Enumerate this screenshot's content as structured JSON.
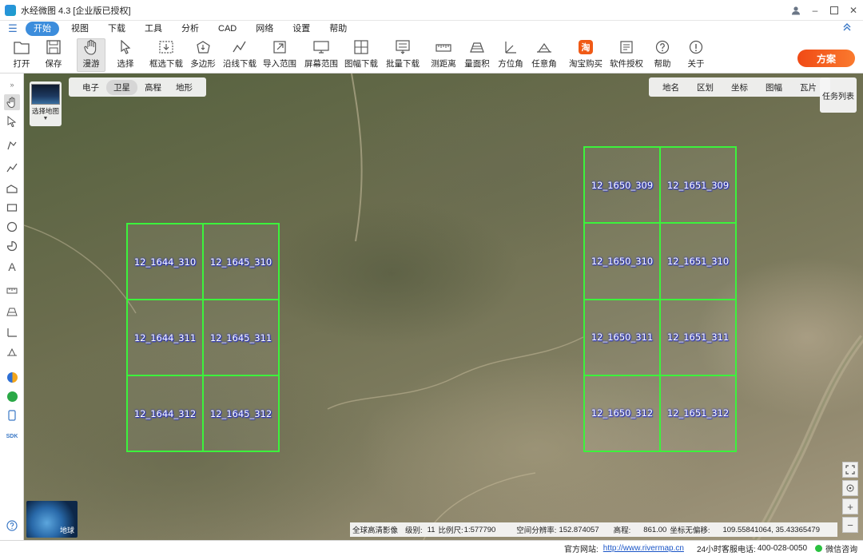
{
  "window": {
    "title": "水经微图 4.3 [企业版已授权]",
    "controls": [
      "user-icon",
      "minimize-icon",
      "maximize-icon",
      "close-icon"
    ]
  },
  "menu": {
    "items": [
      "开始",
      "视图",
      "下载",
      "工具",
      "分析",
      "CAD",
      "网络",
      "设置",
      "帮助"
    ],
    "active": "开始"
  },
  "toolbar": {
    "tools": [
      {
        "label": "打开",
        "icon": "folder-icon"
      },
      {
        "label": "保存",
        "icon": "save-icon"
      },
      {
        "label": "漫游",
        "icon": "hand-icon"
      },
      {
        "label": "选择",
        "icon": "cursor-icon"
      },
      {
        "label": "框选下载",
        "icon": "box-download-icon"
      },
      {
        "label": "多边形",
        "icon": "polygon-download-icon"
      },
      {
        "label": "沿线下载",
        "icon": "line-download-icon"
      },
      {
        "label": "导入范围",
        "icon": "import-icon"
      },
      {
        "label": "屏幕范围",
        "icon": "screen-icon"
      },
      {
        "label": "图幅下载",
        "icon": "grid-download-icon"
      },
      {
        "label": "批量下载",
        "icon": "batch-download-icon"
      },
      {
        "label": "测距离",
        "icon": "ruler-icon"
      },
      {
        "label": "量面积",
        "icon": "area-icon"
      },
      {
        "label": "方位角",
        "icon": "azimuth-icon"
      },
      {
        "label": "任意角",
        "icon": "angle-icon"
      },
      {
        "label": "淘宝购买",
        "icon": "taobao-icon"
      },
      {
        "label": "软件授权",
        "icon": "license-icon"
      },
      {
        "label": "帮助",
        "icon": "help-icon"
      },
      {
        "label": "关于",
        "icon": "info-icon"
      }
    ],
    "promo_label": "方案"
  },
  "map": {
    "type_tabs": [
      "电子",
      "卫星",
      "高程",
      "地形"
    ],
    "active_type": "卫星",
    "overlay_tabs": [
      "地名",
      "区划",
      "坐标",
      "图幅",
      "瓦片"
    ],
    "task_list_label": "任务列表",
    "choose_map_label": "选择地图",
    "globe_label": "地球",
    "tiles_left": [
      "12_1644_310",
      "12_1645_310",
      "12_1644_311",
      "12_1645_311",
      "12_1644_312",
      "12_1645_312"
    ],
    "tiles_right": [
      "12_1650_309",
      "12_1651_309",
      "12_1650_310",
      "12_1651_310",
      "12_1650_311",
      "12_1651_311",
      "12_1650_312",
      "12_1651_312"
    ]
  },
  "map_status": {
    "source": "全球高清影像",
    "level_label": "级别:",
    "level": "11",
    "scale_label": "比例尺:",
    "scale": "1:577790",
    "resolution_label": "空间分辨率:",
    "resolution": "152.874057",
    "elevation_label": "高程:",
    "elevation": "861.00",
    "coord_label": "坐标无偏移:",
    "coords": "109.55841064, 35.43365479"
  },
  "statusbar": {
    "site_label": "官方网站:",
    "site_url": "http://www.rivermap.cn",
    "hotline_label": "24小时客服电话:",
    "hotline": "400-028-0050",
    "wechat_label": "微信咨询"
  },
  "colors": {
    "accent": "#3c8ddc",
    "grid_line": "#3cf23c",
    "tile_label_glow": "#2630c8",
    "promo": "#f04a15"
  }
}
